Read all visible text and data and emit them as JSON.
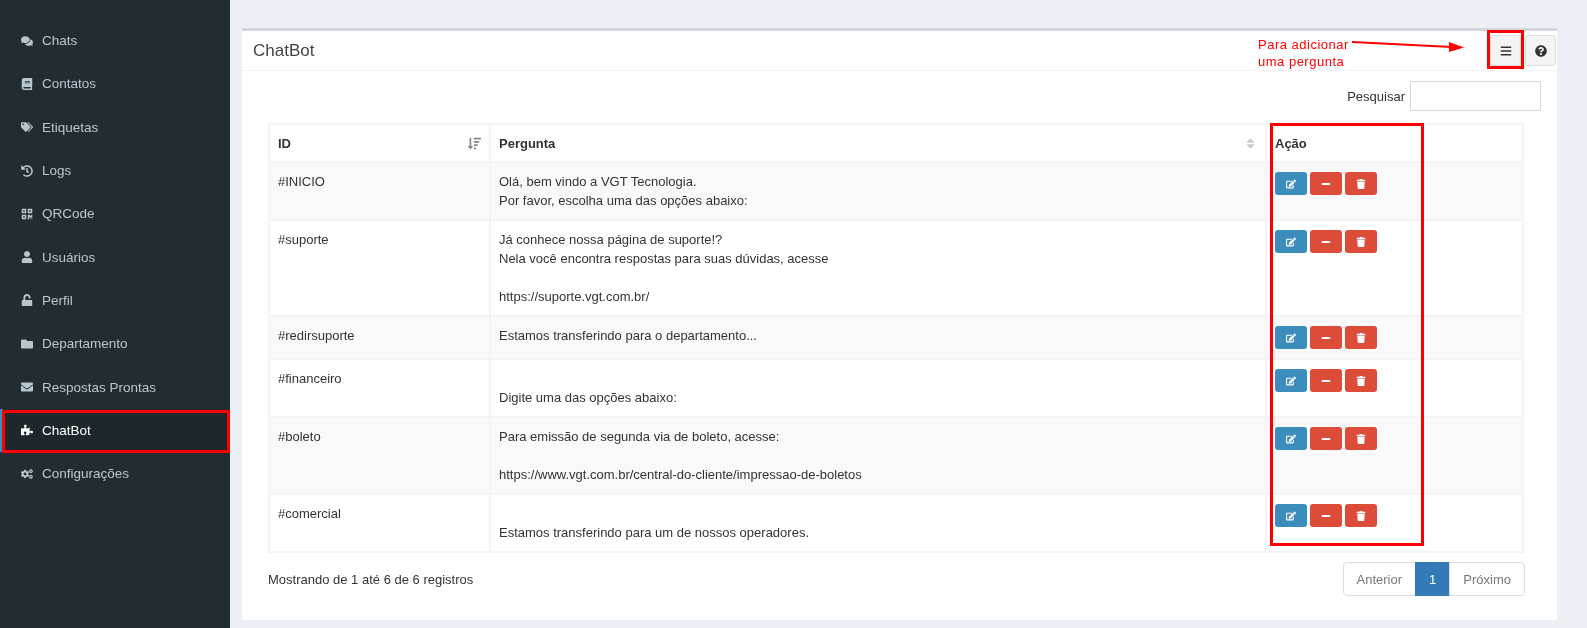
{
  "sidebar": {
    "items": [
      {
        "label": "Chats",
        "selected": false,
        "highlighted": false
      },
      {
        "label": "Contatos",
        "selected": false,
        "highlighted": false
      },
      {
        "label": "Etiquetas",
        "selected": false,
        "highlighted": false
      },
      {
        "label": "Logs",
        "selected": false,
        "highlighted": false
      },
      {
        "label": "QRCode",
        "selected": false,
        "highlighted": false
      },
      {
        "label": "Usuários",
        "selected": false,
        "highlighted": false
      },
      {
        "label": "Perfil",
        "selected": false,
        "highlighted": false
      },
      {
        "label": "Departamento",
        "selected": false,
        "highlighted": false
      },
      {
        "label": "Respostas Prontas",
        "selected": false,
        "highlighted": false
      },
      {
        "label": "ChatBot",
        "selected": true,
        "highlighted": true
      },
      {
        "label": "Configurações",
        "selected": false,
        "highlighted": false
      }
    ]
  },
  "box": {
    "title": "ChatBot",
    "menu_button": {
      "highlighted": true
    },
    "annotation": {
      "lines": [
        "Para adicionar",
        "uma pergunta"
      ]
    },
    "search": {
      "label": "Pesquisar"
    },
    "table": {
      "columns": [
        {
          "label": "ID",
          "sortable": true,
          "sorted": true,
          "highlighted": false
        },
        {
          "label": "Pergunta",
          "sortable": true,
          "sorted": false,
          "highlighted": false
        },
        {
          "label": "Ação",
          "sortable": false,
          "highlighted": true
        }
      ],
      "rows": [
        {
          "id": "#INICIO",
          "pergunta": "Olá, bem vindo a VGT Tecnologia.\nPor favor, escolha uma das opções abaixo:"
        },
        {
          "id": "#suporte",
          "pergunta": "Já conhece nossa página de suporte!?\nNela você encontra respostas para suas dúvidas, acesse\n\nhttps://suporte.vgt.com.br/\n"
        },
        {
          "id": "#redirsuporte",
          "pergunta": "Estamos transferindo para o departamento..."
        },
        {
          "id": "#financeiro",
          "pergunta": "\nDigite uma das opções abaixo:"
        },
        {
          "id": "#boleto",
          "pergunta": "Para emissão de segunda via de boleto, acesse:\n\nhttps://www.vgt.com.br/central-do-cliente/impressao-de-boletos\n"
        },
        {
          "id": "#comercial",
          "pergunta": "\nEstamos transferindo para um de nossos operadores."
        }
      ]
    },
    "info": "Mostrando de 1 até 6 de 6 registros",
    "pagination": [
      {
        "label": "Anterior",
        "selected": false
      },
      {
        "label": "1",
        "selected": true
      },
      {
        "label": "Próximo",
        "selected": false
      }
    ]
  }
}
